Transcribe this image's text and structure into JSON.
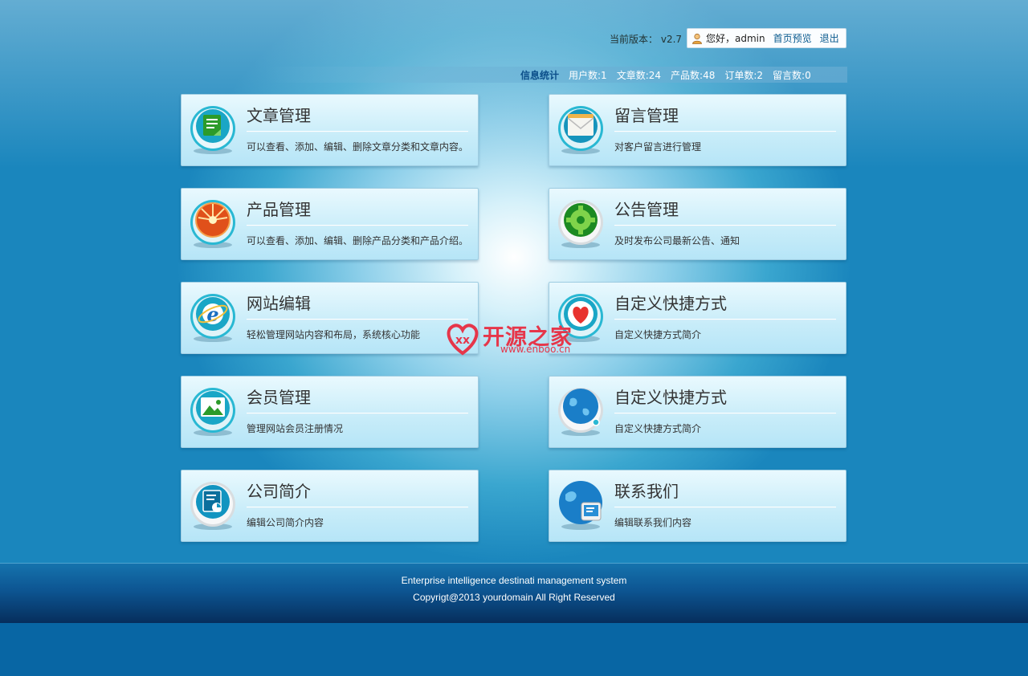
{
  "header": {
    "version_label": "当前版本：",
    "version_value": "v2.7",
    "greeting": "您好，admin",
    "preview_link": "首页预览",
    "logout_link": "退出"
  },
  "stats": {
    "title": "信息统计",
    "items": [
      "用户数:1",
      "文章数:24",
      "产品数:48",
      "订单数:2",
      "留言数:0"
    ]
  },
  "cards": [
    {
      "title": "文章管理",
      "desc": "可以查看、添加、编辑、删除文章分类和文章内容。",
      "icon": "document-icon"
    },
    {
      "title": "留言管理",
      "desc": "对客户留言进行管理",
      "icon": "envelope-icon"
    },
    {
      "title": "产品管理",
      "desc": "可以查看、添加、编辑、删除产品分类和产品介绍。",
      "icon": "sunburst-icon"
    },
    {
      "title": "公告管理",
      "desc": "及时发布公司最新公告、通知",
      "icon": "gear-icon"
    },
    {
      "title": "网站编辑",
      "desc": "轻松管理网站内容和布局，系统核心功能",
      "icon": "browser-e-icon"
    },
    {
      "title": "自定义快捷方式",
      "desc": "自定义快捷方式简介",
      "icon": "heart-icon"
    },
    {
      "title": "会员管理",
      "desc": "管理网站会员注册情况",
      "icon": "picture-icon"
    },
    {
      "title": "自定义快捷方式",
      "desc": "自定义快捷方式简介",
      "icon": "globe-icon"
    },
    {
      "title": "公司简介",
      "desc": "编辑公司简介内容",
      "icon": "report-icon"
    },
    {
      "title": "联系我们",
      "desc": "编辑联系我们内容",
      "icon": "globe-monitor-icon"
    }
  ],
  "watermark": {
    "title": "开源之家",
    "url": "www.enboo.cn"
  },
  "footer": {
    "line1": "Enterprise intelligence destinati management system",
    "line2": "Copyrigt@2013 yourdomain All Right Reserved"
  }
}
